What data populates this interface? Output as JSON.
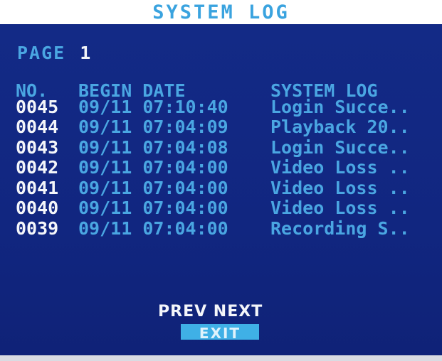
{
  "title": "SYSTEM LOG",
  "page": {
    "label": "PAGE",
    "number": "1"
  },
  "columns": {
    "no": "NO.",
    "begin_date": "BEGIN DATE",
    "system_log": "SYSTEM LOG"
  },
  "rows": [
    {
      "no": "0045",
      "date": "09/11",
      "time": "07:10:40",
      "log": "Login Succe.."
    },
    {
      "no": "0044",
      "date": "09/11",
      "time": "07:04:09",
      "log": "Playback 20.."
    },
    {
      "no": "0043",
      "date": "09/11",
      "time": "07:04:08",
      "log": "Login Succe.."
    },
    {
      "no": "0042",
      "date": "09/11",
      "time": "07:04:00",
      "log": "Video Loss .."
    },
    {
      "no": "0041",
      "date": "09/11",
      "time": "07:04:00",
      "log": "Video Loss .."
    },
    {
      "no": "0040",
      "date": "09/11",
      "time": "07:04:00",
      "log": "Video Loss .."
    },
    {
      "no": "0039",
      "date": "09/11",
      "time": "07:04:00",
      "log": "Recording S.."
    }
  ],
  "nav": {
    "prev": "PREV",
    "next": "NEXT",
    "exit": "EXIT"
  },
  "colors": {
    "panel_background": "#112780",
    "accent_text": "#4aa6e2",
    "number_text": "#f4f6fa",
    "exit_button": "#3fb0e6"
  }
}
